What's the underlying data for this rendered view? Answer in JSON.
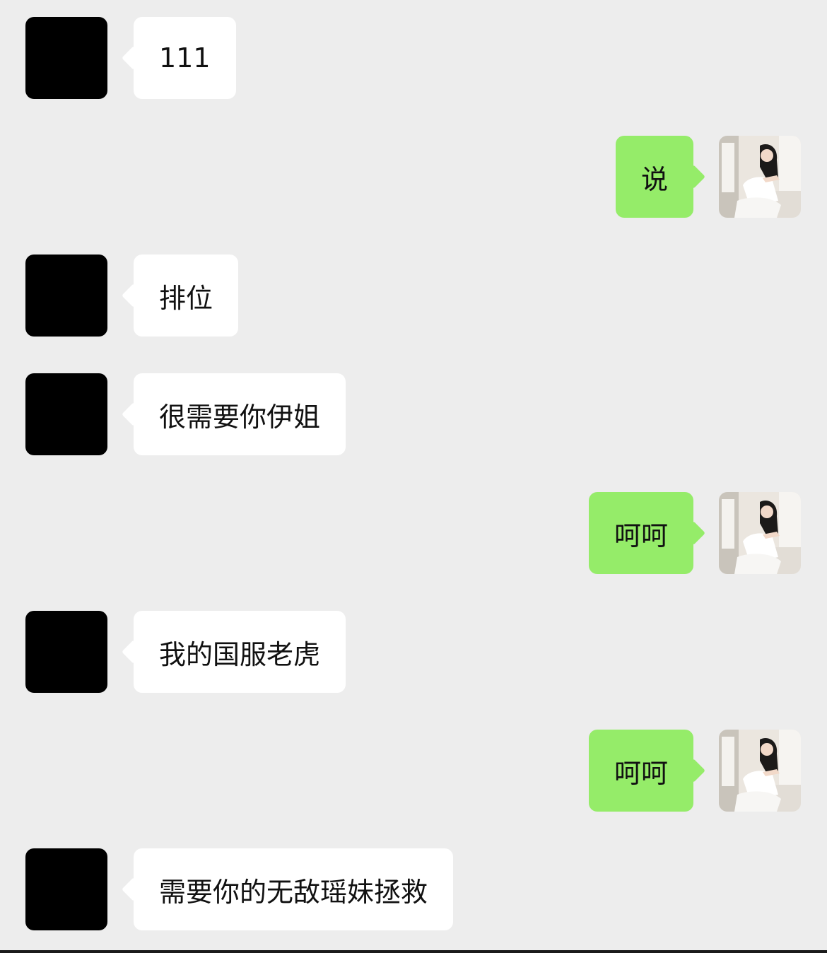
{
  "colors": {
    "background": "#ededed",
    "incoming_bubble": "#ffffff",
    "outgoing_bubble": "#95ec69",
    "incoming_avatar": "#000000",
    "text": "#111111"
  },
  "messages": [
    {
      "side": "left",
      "text": "111",
      "avatar": "black-avatar-icon"
    },
    {
      "side": "right",
      "text": "说",
      "avatar": "user-photo-avatar"
    },
    {
      "side": "left",
      "text": "排位",
      "avatar": "black-avatar-icon"
    },
    {
      "side": "left",
      "text": "很需要你伊姐",
      "avatar": "black-avatar-icon"
    },
    {
      "side": "right",
      "text": "呵呵",
      "avatar": "user-photo-avatar"
    },
    {
      "side": "left",
      "text": "我的国服老虎",
      "avatar": "black-avatar-icon"
    },
    {
      "side": "right",
      "text": "呵呵",
      "avatar": "user-photo-avatar"
    },
    {
      "side": "left",
      "text": "需要你的无敌瑶妹拯救",
      "avatar": "black-avatar-icon"
    }
  ]
}
